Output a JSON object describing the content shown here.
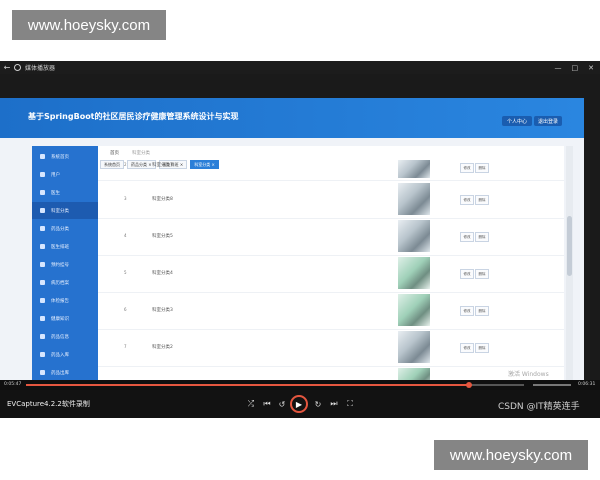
{
  "watermark_top": "www.hoeysky.com",
  "watermark_bottom": "www.hoeysky.com",
  "player": {
    "window_title": "媒体播放器",
    "back_icon": "arrow-left-icon",
    "window_buttons": [
      "—",
      "□",
      "✕"
    ]
  },
  "app": {
    "title": "基于SpringBoot的社区居民诊疗健康管理系统设计与实现",
    "header_buttons": [
      "个人中心",
      "退出登录"
    ],
    "sidebar": [
      {
        "label": "系统首页"
      },
      {
        "label": "用户"
      },
      {
        "label": "医生"
      },
      {
        "label": "科室分类"
      },
      {
        "label": "药品分类"
      },
      {
        "label": "医生排班"
      },
      {
        "label": "预约挂号"
      },
      {
        "label": "病历档案"
      },
      {
        "label": "体检报告"
      },
      {
        "label": "健康知识"
      },
      {
        "label": "药品信息"
      },
      {
        "label": "药品入库"
      },
      {
        "label": "药品出库"
      },
      {
        "label": "系统管理"
      }
    ],
    "active_index": 3,
    "breadcrumb": "首页",
    "breadcrumb_current": "科室分类",
    "tabs": [
      {
        "label": "系统首页",
        "active": false
      },
      {
        "label": "药品分类 ×",
        "active": false
      },
      {
        "label": "医生排班 ×",
        "active": false
      },
      {
        "label": "科室分类 ×",
        "active": true
      }
    ],
    "rows": [
      {
        "num": "2",
        "name": "科室分类7"
      },
      {
        "num": "3",
        "name": "科室分类8"
      },
      {
        "num": "4",
        "name": "科室分类5"
      },
      {
        "num": "5",
        "name": "科室分类4"
      },
      {
        "num": "6",
        "name": "科室分类3"
      },
      {
        "num": "7",
        "name": "科室分类2"
      }
    ],
    "row_actions": [
      "修改",
      "删除"
    ],
    "activate_text": "激活 Windows",
    "activate_sub": "转到\"设置\"以激活 Windows。"
  },
  "progress": {
    "elapsed": "0:05:47",
    "total": "0:06:31",
    "fraction": 0.89
  },
  "controls": {
    "label": "EVCapture4.2.2软件录制",
    "buttons": [
      "⤮",
      "⏮",
      "↺",
      "▶",
      "↻",
      "⏭",
      "⛶"
    ],
    "csdn": "CSDN @IT精英连手"
  },
  "colors": {
    "header": "#1d6fc9",
    "sidebar": "#2672cf",
    "accent": "#e4563f"
  }
}
